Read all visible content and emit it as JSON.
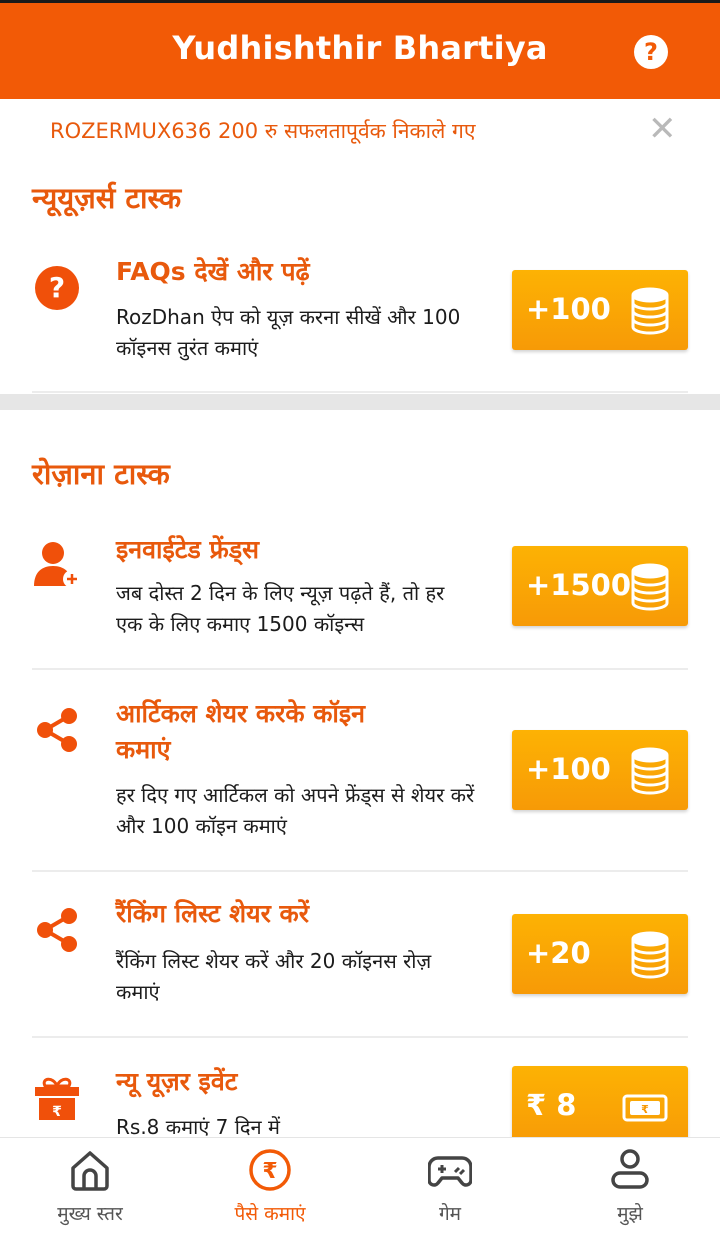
{
  "header": {
    "title": "Yudhishthir Bhartiya",
    "help_label": "?"
  },
  "notice": {
    "text": "ROZERMUX636 200 रु सफलतापूर्वक  निकाले गए",
    "close_label": "✕"
  },
  "sections": [
    {
      "title": "न्यूयूज़र्स टास्क",
      "tasks": [
        {
          "title": "FAQs देखें और पढ़ें",
          "description": "RozDhan ऐप को यूज़ करना सीखें और 100 कॉइनस तुरंत कमाएं",
          "reward": "+100",
          "icon": "question-circle-icon"
        }
      ]
    },
    {
      "title": "रोज़ाना टास्क",
      "tasks": [
        {
          "title": "इनवाईटेड फ्रेंड्स",
          "description": "जब दोस्त 2 दिन के लिए न्यूज़ पढ़ते हैं, तो हर एक के लिए कमाए 1500 कॉइन्स",
          "reward": "+1500",
          "icon": "add-user-icon"
        },
        {
          "title": "आर्टिकल शेयर करके कॉइन कमाएं",
          "description": "हर दिए गए आर्टिकल को अपने फ्रेंड्स से शेयर करें और 100 कॉइन कमाएं",
          "reward": "+100",
          "icon": "share-icon"
        },
        {
          "title": "रैंकिंग लिस्ट शेयर करें",
          "description": "रैंकिंग लिस्ट शेयर करें और 20 कॉइनस रोज़ कमाएं",
          "reward": "+20",
          "icon": "share-icon"
        },
        {
          "title": "न्यू यूज़र इवेंट",
          "description": "Rs.8 कमाएं 7 दिन में",
          "reward": "₹ 8",
          "icon": "gift-icon"
        }
      ]
    }
  ],
  "bottom_nav": [
    {
      "label": "मुख्य स्तर",
      "icon": "home-icon",
      "active": false
    },
    {
      "label": "पैसे कमाएं",
      "icon": "rupee-icon",
      "active": true
    },
    {
      "label": "गेम",
      "icon": "gamepad-icon",
      "active": false
    },
    {
      "label": "मुझे",
      "icon": "profile-icon",
      "active": false
    }
  ],
  "colors": {
    "brand": "#f25a06",
    "accent_text": "#e8590c",
    "reward_top": "#fdb204",
    "reward_bottom": "#f79a06"
  }
}
